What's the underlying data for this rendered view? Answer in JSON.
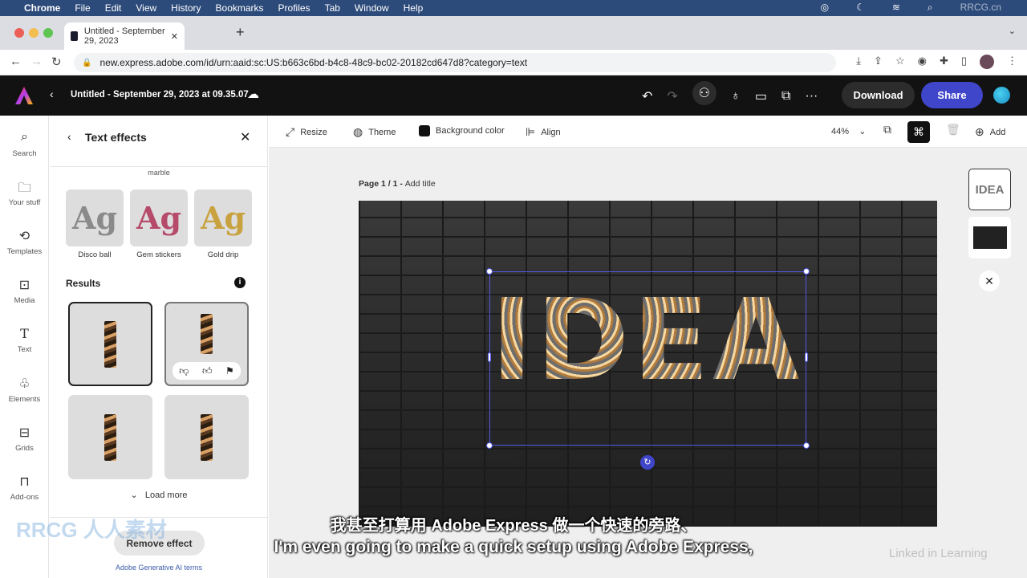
{
  "menubar": {
    "app": "Chrome",
    "items": [
      "File",
      "Edit",
      "View",
      "History",
      "Bookmarks",
      "Profiles",
      "Tab",
      "Window",
      "Help"
    ]
  },
  "browser": {
    "tab_title": "Untitled - September 29, 2023",
    "url": "new.express.adobe.com/id/urn:aaid:sc:US:b663c6bd-b4c8-48c9-bc02-20182cd647d8?category=text"
  },
  "header": {
    "doc_title": "Untitled - September 29, 2023 at 09.35.07",
    "download": "Download",
    "share": "Share",
    "brand_color": "#4046ca"
  },
  "rail": [
    {
      "label": "Search",
      "icon": "search-icon"
    },
    {
      "label": "Your stuff",
      "icon": "folder-icon"
    },
    {
      "label": "Templates",
      "icon": "templates-icon"
    },
    {
      "label": "Media",
      "icon": "media-icon"
    },
    {
      "label": "Text",
      "icon": "text-icon"
    },
    {
      "label": "Elements",
      "icon": "elements-icon"
    },
    {
      "label": "Grids",
      "icon": "grids-icon"
    },
    {
      "label": "Add-ons",
      "icon": "addons-icon"
    }
  ],
  "panel": {
    "title": "Text effects",
    "prev_label": "marble",
    "effects": [
      {
        "label": "Disco ball",
        "sample": "Ag"
      },
      {
        "label": "Gem stickers",
        "sample": "Ag"
      },
      {
        "label": "Gold drip",
        "sample": "Ag"
      }
    ],
    "results_title": "Results",
    "load_more": "Load more",
    "remove": "Remove effect",
    "terms": "Adobe Generative AI terms"
  },
  "toolbar": {
    "resize": "Resize",
    "theme": "Theme",
    "background": "Background color",
    "align": "Align",
    "zoom": "44%",
    "add": "Add"
  },
  "page": {
    "label": "Page 1 / 1 - ",
    "add_title": "Add title",
    "text": "IDEA"
  },
  "thumbs": {
    "page_text": "IDEA"
  },
  "subtitles": {
    "zh": "我甚至打算用 Adobe Express 做一个快速的旁路、",
    "en": "I'm even going to make a quick setup using Adobe Express,"
  },
  "watermarks": {
    "corner": "RRCG.cn",
    "linkedin": "Linked in Learning",
    "rrcg": "RRCG 人人素材"
  }
}
